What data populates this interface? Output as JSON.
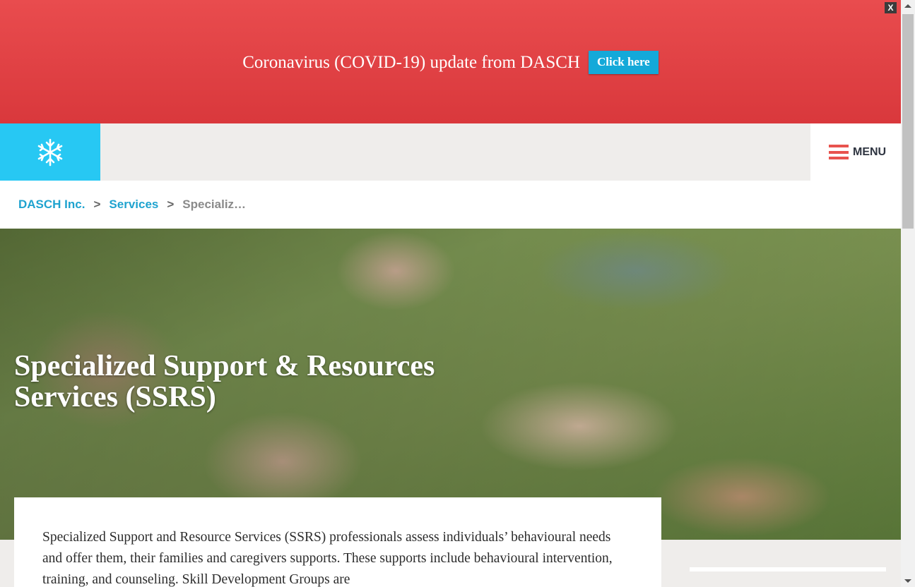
{
  "banner": {
    "text": "Coronavirus (COVID-19) update from DASCH",
    "button_label": "Click here",
    "close_label": "X",
    "bg_color": "#e94c4e"
  },
  "header": {
    "logo_icon": "snowflake-logo-icon",
    "logo_color": "#27c8f3",
    "menu_label": "MENU",
    "menu_icon": "hamburger-icon"
  },
  "breadcrumb": {
    "items": [
      {
        "label": "DASCH Inc."
      },
      {
        "label": "Services"
      }
    ],
    "separator": ">",
    "current": "Specializ…"
  },
  "hero": {
    "title": "Specialized Support & Resources Services (SSRS)"
  },
  "content": {
    "paragraph": "Specialized Support and Resource Services (SSRS) professionals assess individuals’ behavioural needs and offer them, their families and caregivers supports. These supports include behavioural intervention, training, and counseling. Skill Development Groups are"
  }
}
